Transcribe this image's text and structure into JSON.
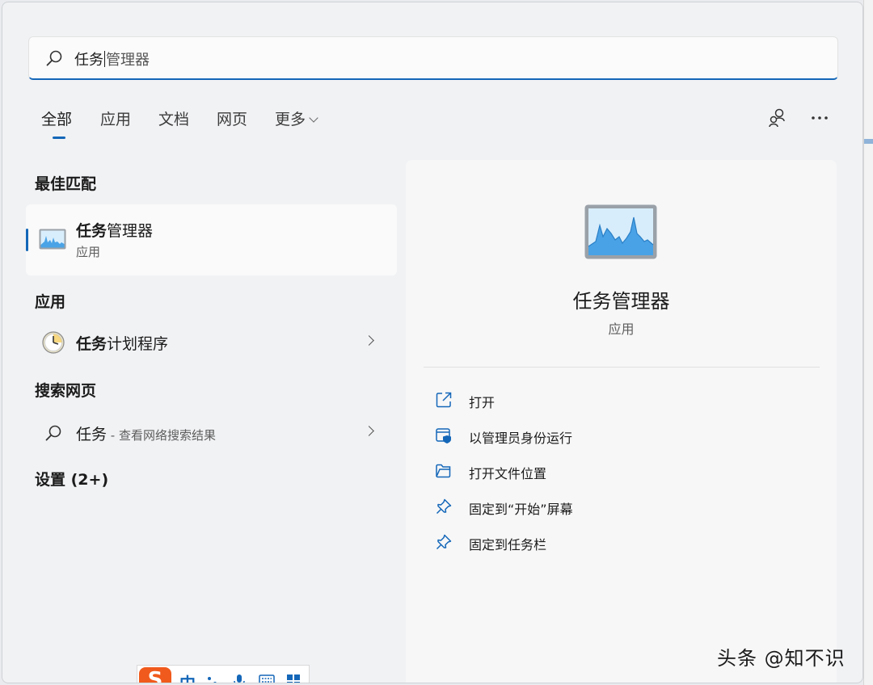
{
  "search": {
    "typed": "任务",
    "suggest_rest": "管理器"
  },
  "tabs": [
    {
      "label": "全部"
    },
    {
      "label": "应用"
    },
    {
      "label": "文档"
    },
    {
      "label": "网页"
    },
    {
      "label": "更多"
    }
  ],
  "toolbar_icons": [
    "account-switch-icon",
    "more-options-icon"
  ],
  "sections": {
    "best_match": "最佳匹配",
    "apps": "应用",
    "web_search": "搜索网页",
    "settings": "设置 (2+)"
  },
  "best_match": {
    "title_highlight": "任务",
    "title_rest": "管理器",
    "subtitle": "应用",
    "icon": "task-manager-icon"
  },
  "app_result": {
    "title_highlight": "任务",
    "title_rest": "计划程序",
    "icon": "task-scheduler-icon"
  },
  "web_result": {
    "query": "任务",
    "suffix": " - 查看网络搜索结果",
    "icon": "search-icon"
  },
  "detail": {
    "title": "任务管理器",
    "subtitle": "应用",
    "actions": [
      {
        "label": "打开",
        "icon": "open-external-icon"
      },
      {
        "label": "以管理员身份运行",
        "icon": "run-as-admin-icon"
      },
      {
        "label": "打开文件位置",
        "icon": "folder-icon"
      },
      {
        "label": "固定到“开始”屏幕",
        "icon": "pin-icon"
      },
      {
        "label": "固定到任务栏",
        "icon": "pin-icon"
      }
    ]
  },
  "ime": {
    "logo": "S",
    "mode": "中"
  },
  "watermark": "头条 @知不识",
  "colors": {
    "accent": "#1467b8",
    "ime_brand": "#f05a1c"
  }
}
